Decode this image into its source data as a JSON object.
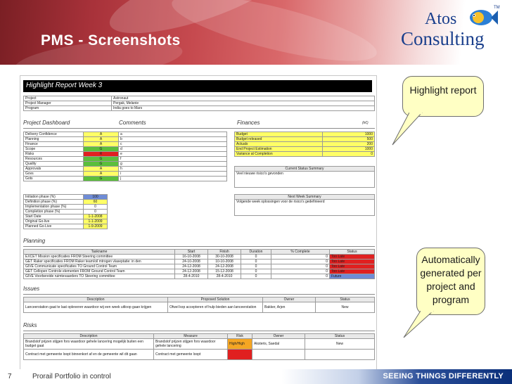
{
  "slide": {
    "title": "PMS - Screenshots",
    "page_number": "7",
    "footer_text": "Prorail Portfolio in control",
    "slogan": "SEEING THINGS DIFFERENTLY",
    "logo": {
      "line1": "Atos",
      "line2": "Consulting",
      "tm": "TM"
    }
  },
  "report": {
    "heading": "Highlight Report Week  3",
    "info": [
      [
        "Project",
        "Astronaut"
      ],
      [
        "Project Manager",
        "Pergak, Melanie"
      ],
      [
        "Program",
        "India goes to Mars"
      ]
    ],
    "dashboard_title": "Project Dashboard",
    "comments_title": "Comments",
    "finances_title": "Finances",
    "finances_unit": "(k€)",
    "dashboard": [
      [
        "Delivery Confidence",
        "A",
        "y",
        "a"
      ],
      [
        "Planning",
        "A",
        "y",
        "b"
      ],
      [
        "Finance",
        "A",
        "y",
        "c"
      ],
      [
        "Scope",
        "G",
        "g",
        "d"
      ],
      [
        "Risks",
        "R",
        "r",
        "e"
      ],
      [
        "Resources",
        "G",
        "g",
        "f"
      ],
      [
        "Quality",
        "G",
        "g",
        "g"
      ],
      [
        "Approvals",
        "A",
        "y",
        "h"
      ],
      [
        "Govs",
        "A",
        "y",
        "i"
      ],
      [
        "Gots",
        "G",
        "g",
        "j"
      ]
    ],
    "finances": [
      [
        "Budget",
        "1000"
      ],
      [
        "Budget released",
        "500"
      ],
      [
        "Actuals",
        "200"
      ],
      [
        "End Project Estimation",
        "1000"
      ],
      [
        "Variance at Completion",
        "0"
      ]
    ],
    "current_status_label": "Current Status Summary",
    "current_status_text": "Veel nieuwe risico's gevonden",
    "phases": [
      [
        "Initiation phase (%)",
        "100",
        "b"
      ],
      [
        "Definition phase (%)",
        "60",
        "y"
      ],
      [
        "Implementation phase (%)",
        "0",
        ""
      ],
      [
        "Completion phase (%)",
        "0",
        ""
      ],
      [
        "Start Date",
        "1-1-2008",
        "y"
      ],
      [
        "Original Go-live",
        "1-1-2009",
        "y"
      ],
      [
        "Planned Go-Live",
        "1-9-2009",
        "y"
      ]
    ],
    "next_week_label": "Next Week Summary",
    "next_week_text": "Volgende week oplossingen voor de risico's gedefinieerd",
    "planning_title": "Planning",
    "planning_headers": [
      "Taskname",
      "Start",
      "Finish",
      "Duration",
      "% Complete",
      "Status"
    ],
    "planning_rows": [
      [
        "EXCET Mission specificaties FROM Steering committee",
        "16-10-2008",
        "30-10-2008",
        "0",
        "0",
        "Too Late",
        "r"
      ],
      [
        "GET Raker specificaties FROM Raker team/oil mtrogen vlaseptatie: in den",
        "24-10-2008",
        "10-10-2008",
        "0",
        "0",
        "Too Late",
        "r"
      ],
      [
        "GIVE Communicate specificaties TO Ground Control Team",
        "24-12-2008",
        "24-12-2008",
        "0",
        "0",
        "Too Late",
        "r"
      ],
      [
        "GET Cellopen Controle elementen FROM Ground Control Team",
        "24-12-2008",
        "15-12-2008",
        "0",
        "0",
        "Too Late",
        "r"
      ],
      [
        "GIVE Voorbereide ruimtevaarders TO Steering committee",
        "28-4-2010",
        "28-4-2010",
        "0",
        "0",
        "Future",
        "b"
      ]
    ],
    "issues_title": "Issues",
    "issues_headers": [
      "Description",
      "Proposed Solution",
      "Owner",
      "Status"
    ],
    "issues_rows": [
      [
        "Lanceerstation gaat te laat opleveren waardoor wij een week uitloop gaan krijgen",
        "Ofwel kop accepteren of hulp bieden aan lanceerstation",
        "Bakker, Arjen",
        "New"
      ]
    ],
    "risks_title": "Risks",
    "risks_headers": [
      "Description",
      "Measure",
      "Risk",
      "Owner",
      "Status"
    ],
    "risks_rows": [
      [
        "Brandstof prijzen stijgen fors waardoor gehele lancering mogelijk buiten een budget gaat",
        "Brandstof prijzen stijgen fors waardoor gehele lancering",
        "High/High",
        "Aksteris, Saedal",
        "New",
        "o"
      ],
      [
        "Contract met gemeente loopt binnenkort af en de gemeente wil dit gaan",
        "Contract met gemeente loopt",
        "",
        "",
        "",
        "r"
      ]
    ]
  },
  "callouts": {
    "top": "Highlight report",
    "bottom": "Automatically generated per project and program"
  },
  "colors": {
    "banner_dark": "#7a1f24",
    "brand_blue": "#1a3f8c",
    "callout_fill": "#ffffc4",
    "header_black": "#000000"
  }
}
